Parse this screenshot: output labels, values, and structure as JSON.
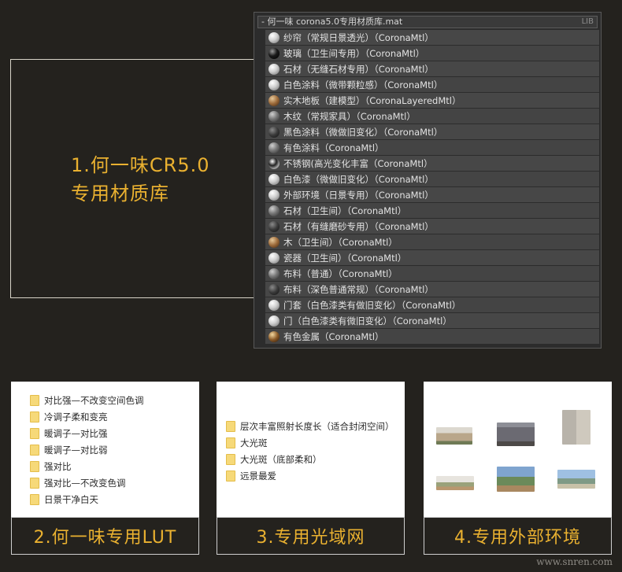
{
  "hero": {
    "line1": "1.何一味CR5.0",
    "line2": "专用材质库"
  },
  "library": {
    "title": "- 何一味 corona5.0专用材质库.mat",
    "tag": "LIB",
    "items": [
      {
        "label": "纱帘（常规日景透光）（CoronaMtl）",
        "ball": "white"
      },
      {
        "label": "玻璃（卫生间专用）（CoronaMtl）",
        "ball": "black"
      },
      {
        "label": "石材（无缝石材专用）（CoronaMtl）",
        "ball": "white"
      },
      {
        "label": "白色涂料（微带颗粒感）（CoronaMtl）",
        "ball": "white"
      },
      {
        "label": "实木地板（建模型）（CoronaLayeredMtl）",
        "ball": "wood"
      },
      {
        "label": "木纹（常规家具）（CoronaMtl）",
        "ball": "grey"
      },
      {
        "label": "黑色涂料（微做旧变化）（CoronaMtl）",
        "ball": "dark"
      },
      {
        "label": "有色涂料（CoronaMtl）",
        "ball": "grey"
      },
      {
        "label": "不锈钢(高光变化丰富（CoronaMtl）",
        "ball": "chrome"
      },
      {
        "label": "白色漆（微做旧变化）（CoronaMtl）",
        "ball": "white"
      },
      {
        "label": "外部环境（日景专用）（CoronaMtl）",
        "ball": "white"
      },
      {
        "label": "石材（卫生间）（CoronaMtl）",
        "ball": "grey"
      },
      {
        "label": "石材（有缝磨砂专用）（CoronaMtl）",
        "ball": "dark"
      },
      {
        "label": "木（卫生间）（CoronaMtl）",
        "ball": "wood"
      },
      {
        "label": "瓷器（卫生间）（CoronaMtl）",
        "ball": "white"
      },
      {
        "label": "布料（普通）（CoronaMtl）",
        "ball": "grey"
      },
      {
        "label": "布料（深色普通常规）（CoronaMtl）",
        "ball": "dark"
      },
      {
        "label": "门套（白色漆类有做旧变化）（CoronaMtl）",
        "ball": "white"
      },
      {
        "label": "门（白色漆类有微旧变化）（CoronaMtl）",
        "ball": "white"
      },
      {
        "label": "有色金属（CoronaMtl）",
        "ball": "gold"
      }
    ]
  },
  "lut_card": {
    "footer": "2.何一味专用LUT",
    "folders": [
      "对比强—不改变空间色调",
      "冷调子柔和变亮",
      "暖调子—对比强",
      "暖调子—对比弱",
      "强对比",
      "强对比—不改变色调",
      "日景干净白天"
    ]
  },
  "ies_card": {
    "footer": "3.专用光域网",
    "folders": [
      "层次丰富照射长度长（适合封闭空间）",
      "大光斑",
      "大光斑（底部柔和）",
      "远景最爱"
    ]
  },
  "env_card": {
    "footer": "4.专用外部环境"
  },
  "watermark": "www.snren.com",
  "colors": {
    "accent": "#eab130",
    "background": "#24221e",
    "folder": "#f6d979"
  }
}
